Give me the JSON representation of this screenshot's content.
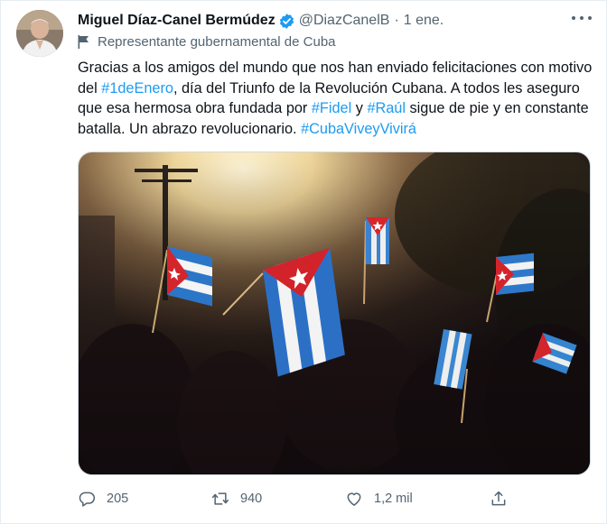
{
  "author": {
    "name": "Miguel Díaz-Canel Bermúdez",
    "handle": "@DiazCanelB",
    "separator": "·",
    "date": "1 ene."
  },
  "label": "Representante gubernamental de Cuba",
  "tweet": {
    "parts": [
      {
        "text": "Gracias a los amigos del mundo que nos han enviado felicitaciones con motivo del ",
        "hashtag": false
      },
      {
        "text": "#1deEnero",
        "hashtag": true
      },
      {
        "text": ", día del Triunfo de la Revolución Cubana. A todos les aseguro que esa hermosa obra fundada por ",
        "hashtag": false
      },
      {
        "text": "#Fidel",
        "hashtag": true
      },
      {
        "text": " y ",
        "hashtag": false
      },
      {
        "text": "#Raúl",
        "hashtag": true
      },
      {
        "text": " sigue de pie y en constante batalla. Un abrazo revolucionario. ",
        "hashtag": false
      },
      {
        "text": "#CubaViveyVivirá",
        "hashtag": true
      }
    ]
  },
  "actions": {
    "replies": "205",
    "retweets": "940",
    "likes": "1,2 mil"
  },
  "icons": {
    "verified": "verified-badge-icon",
    "more": "more-options-icon",
    "label": "flag-icon",
    "reply": "reply-icon",
    "retweet": "retweet-icon",
    "like": "heart-icon",
    "share": "share-icon"
  },
  "colors": {
    "hashtag": "#1d9bf0",
    "secondary_text": "#536471",
    "verified": "#1d9bf0"
  }
}
